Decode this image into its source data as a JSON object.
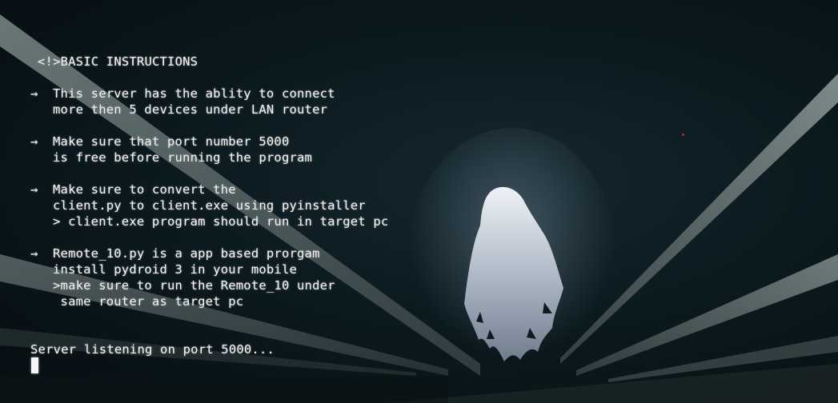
{
  "header": {
    "title": "<!>BASIC INSTRUCTIONS"
  },
  "arrow_glyph": "→",
  "instructions": [
    {
      "lines": [
        "This server has the ablity to connect",
        "more then 5 devices under LAN router"
      ]
    },
    {
      "lines": [
        "Make sure that port number 5000",
        "is free before running the program"
      ]
    },
    {
      "lines": [
        "Make sure to convert the",
        "client.py to client.exe using pyinstaller",
        "> client.exe program should run in target pc"
      ]
    },
    {
      "lines": [
        "Remote_10.py is a app based prorgam",
        "install pydroid 3 in your mobile",
        ">make sure to run the Remote_10 under",
        " same router as target pc"
      ]
    }
  ],
  "status": {
    "text": "Server listening on port 5000..."
  },
  "colors": {
    "text": "#f3f3f3",
    "background": "#0a1519",
    "indicator_dot": "#d0231a"
  }
}
